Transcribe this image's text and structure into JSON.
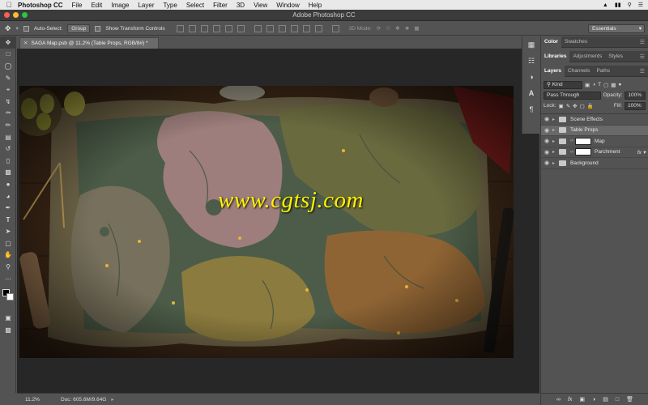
{
  "menubar": {
    "app_name": "Photoshop CC",
    "items": [
      "File",
      "Edit",
      "Image",
      "Layer",
      "Type",
      "Select",
      "Filter",
      "3D",
      "View",
      "Window",
      "Help"
    ]
  },
  "window": {
    "title": "Adobe Photoshop CC"
  },
  "options_bar": {
    "auto_select_label": "Auto-Select:",
    "auto_select_value": "Group",
    "transform_label": "Show Transform Controls",
    "mode_3d_label": "3D Mode:",
    "workspace": "Essentials"
  },
  "document": {
    "tab_title": "SAGA Map.psb @ 11.2% (Table Props, RGB/8#) *",
    "watermark": "www.cgtsj.com"
  },
  "status_bar": {
    "zoom": "11.2%",
    "doc_info": "Doc: 605.6M/9.64G"
  },
  "panels": {
    "top_tabs": [
      "Color",
      "Swatches"
    ],
    "mid_tabs": [
      "Libraries",
      "Adjustments",
      "Styles"
    ],
    "layer_tabs": [
      "Layers",
      "Channels",
      "Paths"
    ],
    "filter_kind": "Kind",
    "blend_mode": "Pass Through",
    "opacity_label": "Opacity:",
    "opacity_value": "100%",
    "lock_label": "Lock:",
    "fill_label": "Fill:",
    "fill_value": "100%",
    "layers": [
      {
        "name": "Scene Effects",
        "kind": "group",
        "selected": false
      },
      {
        "name": "Table Props",
        "kind": "group",
        "selected": true
      },
      {
        "name": "Map",
        "kind": "group-mask",
        "selected": false
      },
      {
        "name": "Parchment",
        "kind": "group-mask",
        "selected": false
      },
      {
        "name": "Background",
        "kind": "group",
        "selected": false
      }
    ]
  }
}
